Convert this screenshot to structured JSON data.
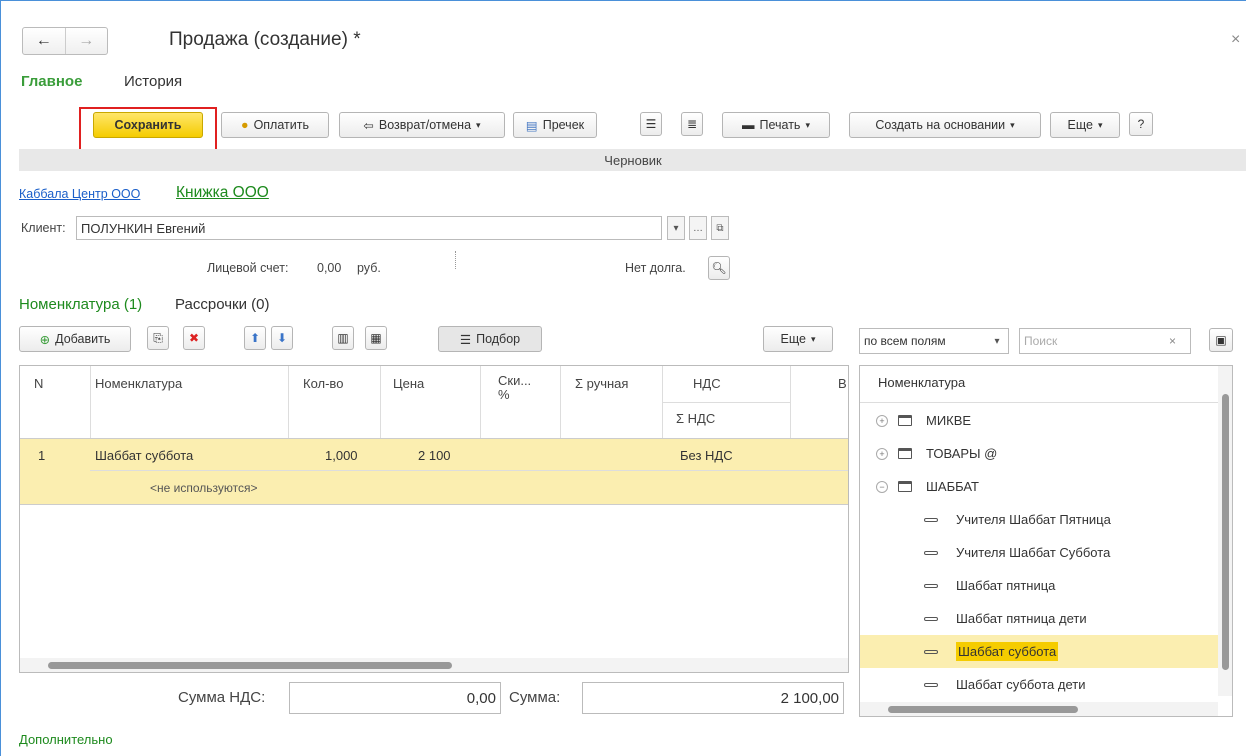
{
  "window": {
    "title": "Продажа (создание) *",
    "close_glyph": "×"
  },
  "nav": {
    "back_glyph": "←",
    "forward_glyph": "→"
  },
  "tabs": {
    "main": "Главное",
    "history": "История"
  },
  "toolbar": {
    "save": "Сохранить",
    "pay": "Оплатить",
    "return": "Возврат/отмена",
    "precheck": "Пречек",
    "print": "Печать",
    "create_based": "Создать на основании",
    "more": "Еще",
    "help": "?"
  },
  "status": "Черновик",
  "org": {
    "company": "Каббала Центр ООО",
    "shop": "Книжка ООО"
  },
  "client": {
    "label": "Клиент:",
    "value": "ПОЛУНКИН Евгений"
  },
  "account": {
    "label": "Лицевой счет:",
    "value": "0,00",
    "currency": "руб.",
    "debt": "Нет долга."
  },
  "sections": {
    "nomenclature": "Номенклатура (1)",
    "installments": "Рассрочки (0)"
  },
  "table_toolbar": {
    "add": "Добавить",
    "pick": "Подбор",
    "more": "Еще"
  },
  "table": {
    "columns": [
      "N",
      "Номенклатура",
      "Кол-во",
      "Цена",
      "Ски... %",
      "Σ ручная",
      "НДС",
      "В"
    ],
    "subheader": "Σ НДС",
    "rows": [
      {
        "n": "1",
        "name": "Шаббат суббота",
        "qty": "1,000",
        "price": "2 100",
        "vat": "Без НДС",
        "sub": "<не используются>"
      }
    ]
  },
  "totals": {
    "vat_label": "Сумма НДС:",
    "vat_value": "0,00",
    "sum_label": "Сумма:",
    "sum_value": "2 100,00"
  },
  "search": {
    "mode": "по всем полям",
    "placeholder": "Поиск",
    "clear": "×"
  },
  "tree": {
    "header": "Номенклатура",
    "groups": [
      {
        "label": "МИКВЕ",
        "expanded": false
      },
      {
        "label": "ТОВАРЫ @",
        "expanded": false
      },
      {
        "label": "ШАББАТ",
        "expanded": true
      }
    ],
    "items": [
      "Учителя Шаббат Пятница",
      "Учителя Шаббат Суббота",
      "Шаббат пятница",
      "Шаббат пятница дети",
      "Шаббат суббота",
      "Шаббат суббота дети"
    ],
    "selected": "Шаббат суббота"
  },
  "footer": {
    "more": "Дополнительно"
  },
  "colors": {
    "accent_green": "#3a9d3a",
    "save_yellow": "#f5cc00",
    "highlight_red": "#e02020",
    "row_selected": "#fbeeb0"
  }
}
